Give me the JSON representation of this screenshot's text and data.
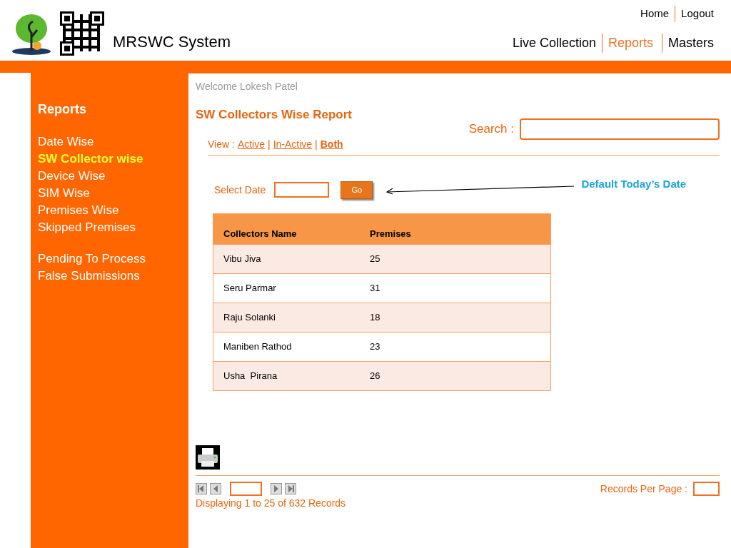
{
  "header": {
    "app_title": "MRSWC System",
    "top_links": [
      "Home",
      "Logout"
    ],
    "nav": [
      {
        "label": "Live Collection",
        "selected": false
      },
      {
        "label": "Reports",
        "selected": true
      },
      {
        "label": "Masters",
        "selected": false
      }
    ]
  },
  "sidebar": {
    "heading": "Reports",
    "groups": [
      [
        {
          "label": "Date Wise",
          "selected": false
        },
        {
          "label": "SW Collector wise",
          "selected": true
        },
        {
          "label": "Device Wise",
          "selected": false
        },
        {
          "label": "SIM Wise",
          "selected": false
        },
        {
          "label": "Premises Wise",
          "selected": false
        },
        {
          "label": "Skipped Premises",
          "selected": false
        }
      ],
      [
        {
          "label": "Pending To Process",
          "selected": false
        },
        {
          "label": "False Submissions",
          "selected": false
        }
      ]
    ]
  },
  "welcome": "Welcome Lokesh Patel",
  "page_title": "SW Collectors Wise Report",
  "search": {
    "label": "Search :"
  },
  "view": {
    "label": "View :",
    "separator": "|",
    "options": [
      {
        "label": "Active",
        "selected": false
      },
      {
        "label": "In-Active",
        "selected": false
      },
      {
        "label": "Both",
        "selected": true
      }
    ]
  },
  "date_filter": {
    "label": "Select Date",
    "button": "Go",
    "annotation": "Default Today’s Date"
  },
  "table": {
    "columns": [
      "Collectors Name",
      "Premises"
    ],
    "rows": [
      [
        "Vibu Jiva",
        "25"
      ],
      [
        "Seru Parmar",
        "31"
      ],
      [
        "Raju Solanki",
        "18"
      ],
      [
        "Maniben Rathod",
        "23"
      ],
      [
        "Usha  Pirana",
        "26"
      ]
    ]
  },
  "pagination": {
    "status": "Displaying 1 to 25 of 632 Records",
    "per_page_label": "Records Per Page :"
  }
}
